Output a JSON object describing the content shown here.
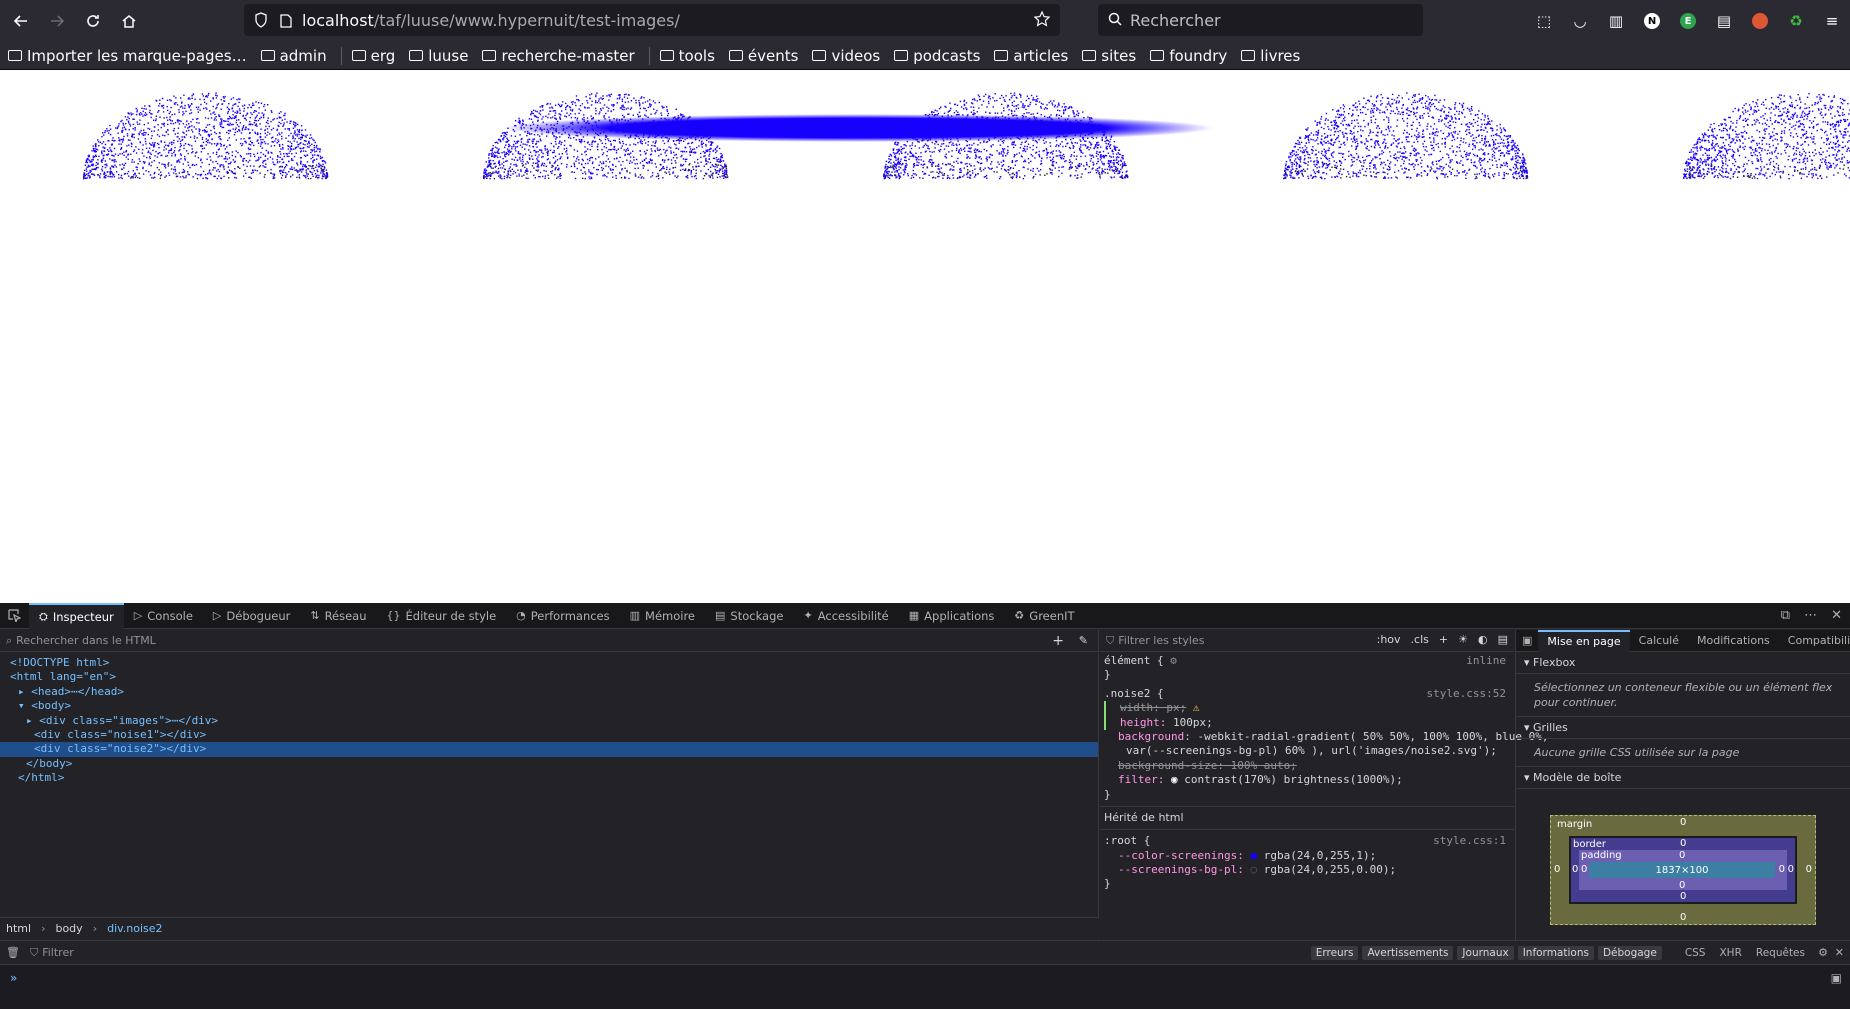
{
  "browser": {
    "url_host": "localhost",
    "url_path": "/taf/luuse/www.hypernuit/test-images/",
    "search_placeholder": "Rechercher",
    "badges": [
      "N",
      "E"
    ]
  },
  "bookmarks": [
    {
      "label": "Importer les marque-pages…",
      "type": "import"
    },
    {
      "label": "admin",
      "type": "folder"
    },
    {
      "label": "erg",
      "type": "folder"
    },
    {
      "label": "luuse",
      "type": "folder"
    },
    {
      "label": "recherche-master",
      "type": "folder"
    },
    {
      "label": "tools",
      "type": "folder"
    },
    {
      "label": "évents",
      "type": "folder"
    },
    {
      "label": "videos",
      "type": "folder"
    },
    {
      "label": "podcasts",
      "type": "folder"
    },
    {
      "label": "articles",
      "type": "folder"
    },
    {
      "label": "sites",
      "type": "folder"
    },
    {
      "label": "foundry",
      "type": "folder"
    },
    {
      "label": "livres",
      "type": "folder"
    }
  ],
  "devtools": {
    "tabs": [
      {
        "label": "Inspecteur",
        "icon": "⛭"
      },
      {
        "label": "Console",
        "icon": "▷"
      },
      {
        "label": "Débogueur",
        "icon": "▷"
      },
      {
        "label": "Réseau",
        "icon": "⇅"
      },
      {
        "label": "Éditeur de style",
        "icon": "{}"
      },
      {
        "label": "Performances",
        "icon": "◔"
      },
      {
        "label": "Mémoire",
        "icon": "▥"
      },
      {
        "label": "Stockage",
        "icon": "▤"
      },
      {
        "label": "Accessibilité",
        "icon": "✦"
      },
      {
        "label": "Applications",
        "icon": "▦"
      },
      {
        "label": "GreenIT",
        "icon": "♻"
      }
    ],
    "html_search_placeholder": "Rechercher dans le HTML",
    "tree": [
      {
        "indent": 0,
        "text": "<!DOCTYPE html>"
      },
      {
        "indent": 0,
        "text": "<html lang=\"en\">"
      },
      {
        "indent": 1,
        "text": "▸ <head>⋯</head>"
      },
      {
        "indent": 1,
        "text": "▾ <body>"
      },
      {
        "indent": 2,
        "text": "▸ <div class=\"images\">⋯</div>"
      },
      {
        "indent": 3,
        "text": "<div class=\"noise1\"></div>"
      },
      {
        "indent": 3,
        "text": "<div class=\"noise2\"></div>",
        "selected": true
      },
      {
        "indent": 2,
        "text": "</body>"
      },
      {
        "indent": 1,
        "text": "</html>"
      }
    ],
    "breadcrumbs": [
      "html",
      "body",
      "div.noise2"
    ],
    "rules_filter_placeholder": "Filtrer les styles",
    "rules_tools": [
      ":hov",
      ".cls"
    ],
    "rules": {
      "element_selector": "élément {",
      "element_source": "inline",
      "noise2_selector": ".noise2 {",
      "noise2_source": "style.css:52",
      "width": "width: px;",
      "height_prop": "height:",
      "height_val": "100px;",
      "background_prop": "background:",
      "background_val1": "-webkit-radial-gradient( 50% 50%, 100% 100%, blue 0%,",
      "background_val2": "var(--screenings-bg-pl) 60% ), url('images/noise2.svg');",
      "background_size": "background-size: 100% auto;",
      "filter_prop": "filter:",
      "filter_val": "contrast(170%) brightness(1000%);",
      "inherited_label": "Hérité de html",
      "root_selector": ":root {",
      "root_source": "style.css:1",
      "var1_prop": "--color-screenings:",
      "var1_val": "rgba(24,0,255,1);",
      "var2_prop": "--screenings-bg-pl:",
      "var2_val": "rgba(24,0,255,0.00);",
      "close": "}"
    },
    "layout_tabs": [
      "Mise en page",
      "Calculé",
      "Modifications",
      "Compatibilité"
    ],
    "flexbox_title": "Flexbox",
    "flexbox_text": "Sélectionnez un conteneur flexible ou un élément flex pour continuer.",
    "grids_title": "Grilles",
    "grids_text": "Aucune grille CSS utilisée sur la page",
    "boxmodel_title": "Modèle de boîte",
    "boxmodel": {
      "margin_label": "margin",
      "border_label": "border",
      "padding_label": "padding",
      "content_size": "1837×100",
      "zero": "0"
    },
    "console": {
      "filter_placeholder": "Filtrer",
      "levels": [
        "Erreurs",
        "Avertissements",
        "Journaux",
        "Informations",
        "Débogage"
      ],
      "extra": [
        "CSS",
        "XHR",
        "Requêtes"
      ],
      "prompt": "»"
    }
  },
  "colors": {
    "accent": "#75bfff",
    "noise_blue": "#1800ff"
  }
}
